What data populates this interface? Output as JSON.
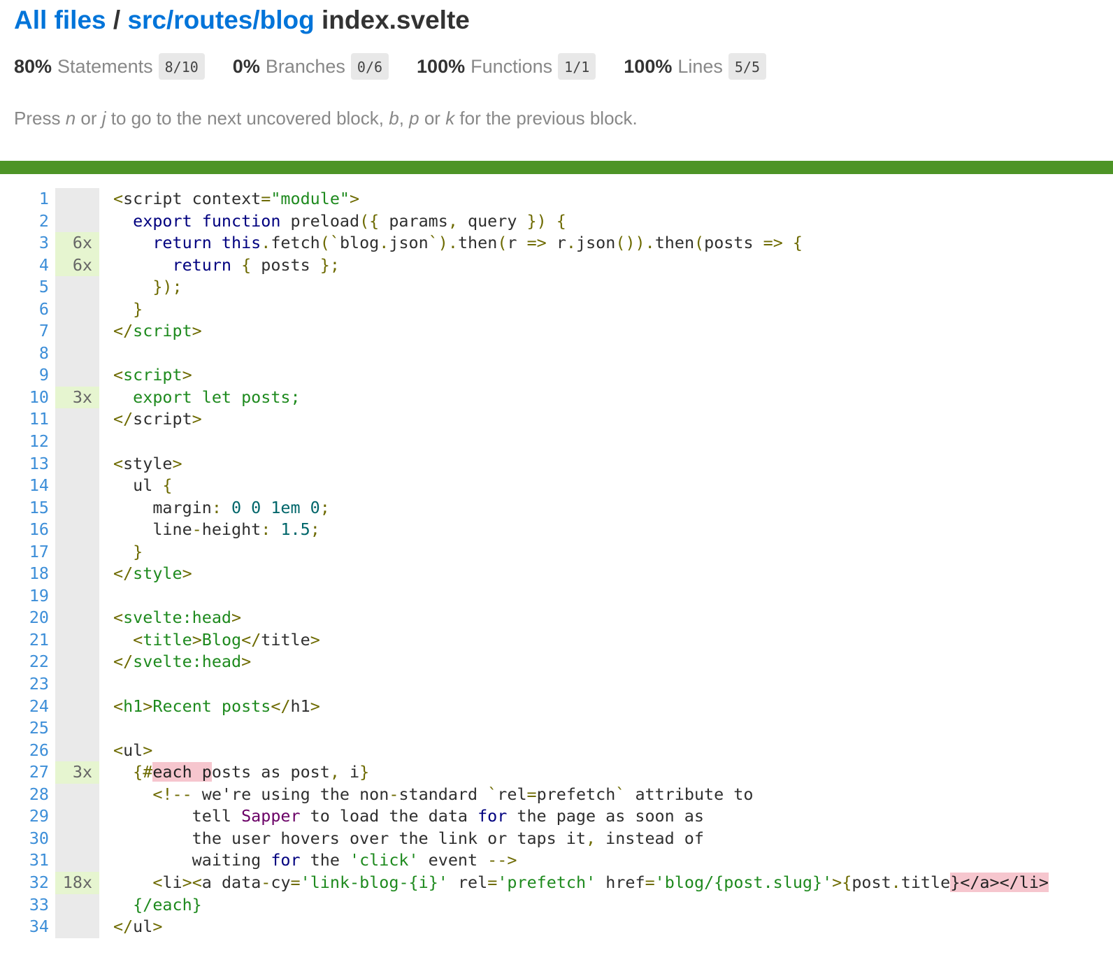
{
  "header": {
    "crumb_root": "All files",
    "crumb_sep": " / ",
    "crumb_dir": "src/routes/blog",
    "file_name": "index.svelte"
  },
  "summary": [
    {
      "pct": "80%",
      "name": "Statements",
      "frac": "8/10"
    },
    {
      "pct": "0%",
      "name": "Branches",
      "frac": "0/6"
    },
    {
      "pct": "100%",
      "name": "Functions",
      "frac": "1/1"
    },
    {
      "pct": "100%",
      "name": "Lines",
      "frac": "5/5"
    }
  ],
  "hint": {
    "p1": "Press ",
    "k1": "n",
    "p2": " or ",
    "k2": "j",
    "p3": " to go to the next uncovered block, ",
    "k3": "b",
    "p4": ", ",
    "k4": "p",
    "p5": " or ",
    "k5": "k",
    "p6": " for the previous block."
  },
  "colors": {
    "status_bar": "#4d9426",
    "link": "#0074d9",
    "covered": "#e6f5d0",
    "uncovered": "#f6c6ce"
  },
  "code_lines": [
    {
      "n": "1",
      "hits": "",
      "segs": [
        [
          "pu",
          "<"
        ],
        [
          "tg",
          "script context"
        ],
        [
          "pu",
          "="
        ],
        [
          "gr",
          "\"module\""
        ],
        [
          "pu",
          ">"
        ]
      ]
    },
    {
      "n": "2",
      "hits": "",
      "segs": [
        [
          "tg",
          "  "
        ],
        [
          "kw",
          "export function"
        ],
        [
          "tg",
          " preload"
        ],
        [
          "pu",
          "({"
        ],
        [
          "tg",
          " params"
        ],
        [
          "pu",
          ","
        ],
        [
          "tg",
          " query "
        ],
        [
          "pu",
          "}) {"
        ]
      ]
    },
    {
      "n": "3",
      "hits": "6x",
      "segs": [
        [
          "tg",
          "    "
        ],
        [
          "kw",
          "return this"
        ],
        [
          "pu",
          "."
        ],
        [
          "tg",
          "fetch"
        ],
        [
          "pu",
          "(`"
        ],
        [
          "tg",
          "blog"
        ],
        [
          "pu",
          "."
        ],
        [
          "tg",
          "json"
        ],
        [
          "pu",
          "`)."
        ],
        [
          "tg",
          "then"
        ],
        [
          "pu",
          "("
        ],
        [
          "tg",
          "r "
        ],
        [
          "pu",
          "=>"
        ],
        [
          "tg",
          " r"
        ],
        [
          "pu",
          "."
        ],
        [
          "tg",
          "json"
        ],
        [
          "pu",
          "())."
        ],
        [
          "tg",
          "then"
        ],
        [
          "pu",
          "("
        ],
        [
          "tg",
          "posts "
        ],
        [
          "pu",
          "=> {"
        ]
      ]
    },
    {
      "n": "4",
      "hits": "6x",
      "segs": [
        [
          "tg",
          "      "
        ],
        [
          "kw",
          "return"
        ],
        [
          "pu",
          " {"
        ],
        [
          "tg",
          " posts "
        ],
        [
          "pu",
          "};"
        ]
      ]
    },
    {
      "n": "5",
      "hits": "",
      "segs": [
        [
          "tg",
          "    "
        ],
        [
          "pu",
          "});"
        ]
      ]
    },
    {
      "n": "6",
      "hits": "",
      "segs": [
        [
          "tg",
          "  "
        ],
        [
          "pu",
          "}"
        ]
      ]
    },
    {
      "n": "7",
      "hits": "",
      "segs": [
        [
          "pu",
          "</"
        ],
        [
          "gr",
          "script"
        ],
        [
          "pu",
          ">"
        ]
      ]
    },
    {
      "n": "8",
      "hits": "",
      "segs": []
    },
    {
      "n": "9",
      "hits": "",
      "segs": [
        [
          "pu",
          "<"
        ],
        [
          "gr",
          "script"
        ],
        [
          "pu",
          ">"
        ]
      ]
    },
    {
      "n": "10",
      "hits": "3x",
      "segs": [
        [
          "tg",
          "  "
        ],
        [
          "gr",
          "export let posts;"
        ]
      ]
    },
    {
      "n": "11",
      "hits": "",
      "segs": [
        [
          "pu",
          "</"
        ],
        [
          "tg",
          "script"
        ],
        [
          "pu",
          ">"
        ]
      ]
    },
    {
      "n": "12",
      "hits": "",
      "segs": []
    },
    {
      "n": "13",
      "hits": "",
      "segs": [
        [
          "pu",
          "<"
        ],
        [
          "tg",
          "style"
        ],
        [
          "pu",
          ">"
        ]
      ]
    },
    {
      "n": "14",
      "hits": "",
      "segs": [
        [
          "tg",
          "  ul "
        ],
        [
          "pu",
          "{"
        ]
      ]
    },
    {
      "n": "15",
      "hits": "",
      "segs": [
        [
          "tg",
          "    margin"
        ],
        [
          "pu",
          ":"
        ],
        [
          "nm",
          " 0 0 1em 0"
        ],
        [
          "pu",
          ";"
        ]
      ]
    },
    {
      "n": "16",
      "hits": "",
      "segs": [
        [
          "tg",
          "    line"
        ],
        [
          "pu",
          "-"
        ],
        [
          "tg",
          "height"
        ],
        [
          "pu",
          ":"
        ],
        [
          "nm",
          " 1.5"
        ],
        [
          "pu",
          ";"
        ]
      ]
    },
    {
      "n": "17",
      "hits": "",
      "segs": [
        [
          "tg",
          "  "
        ],
        [
          "pu",
          "}"
        ]
      ]
    },
    {
      "n": "18",
      "hits": "",
      "segs": [
        [
          "pu",
          "</"
        ],
        [
          "gr",
          "style"
        ],
        [
          "pu",
          ">"
        ]
      ]
    },
    {
      "n": "19",
      "hits": "",
      "segs": []
    },
    {
      "n": "20",
      "hits": "",
      "segs": [
        [
          "pu",
          "<"
        ],
        [
          "gr",
          "svelte:head"
        ],
        [
          "pu",
          ">"
        ]
      ]
    },
    {
      "n": "21",
      "hits": "",
      "segs": [
        [
          "tg",
          "  "
        ],
        [
          "pu",
          "<"
        ],
        [
          "gr",
          "title"
        ],
        [
          "pu",
          ">"
        ],
        [
          "gr",
          "Blog"
        ],
        [
          "pu",
          "</"
        ],
        [
          "tg",
          "title"
        ],
        [
          "pu",
          ">"
        ]
      ]
    },
    {
      "n": "22",
      "hits": "",
      "segs": [
        [
          "pu",
          "</"
        ],
        [
          "gr",
          "svelte:head"
        ],
        [
          "pu",
          ">"
        ]
      ]
    },
    {
      "n": "23",
      "hits": "",
      "segs": []
    },
    {
      "n": "24",
      "hits": "",
      "segs": [
        [
          "pu",
          "<"
        ],
        [
          "gr",
          "h1"
        ],
        [
          "pu",
          ">"
        ],
        [
          "gr",
          "Recent posts"
        ],
        [
          "pu",
          "</"
        ],
        [
          "tg",
          "h1"
        ],
        [
          "pu",
          ">"
        ]
      ]
    },
    {
      "n": "25",
      "hits": "",
      "segs": []
    },
    {
      "n": "26",
      "hits": "",
      "segs": [
        [
          "pu",
          "<"
        ],
        [
          "tg",
          "ul"
        ],
        [
          "pu",
          ">"
        ]
      ]
    },
    {
      "n": "27",
      "hits": "3x",
      "segs": [
        [
          "tg",
          "  "
        ],
        [
          "pu",
          "{#"
        ],
        [
          "uncov",
          "each p"
        ],
        [
          "tg",
          "osts as post"
        ],
        [
          "pu",
          ","
        ],
        [
          "tg",
          " i"
        ],
        [
          "pu",
          "}"
        ]
      ]
    },
    {
      "n": "28",
      "hits": "",
      "segs": [
        [
          "tg",
          "    "
        ],
        [
          "pu",
          "<!--"
        ],
        [
          "tg",
          " we're using the non"
        ],
        [
          "pu",
          "-"
        ],
        [
          "tg",
          "standard "
        ],
        [
          "pu",
          "`"
        ],
        [
          "tg",
          "rel"
        ],
        [
          "pu",
          "="
        ],
        [
          "tg",
          "prefetch"
        ],
        [
          "pu",
          "`"
        ],
        [
          "tg",
          " attribute to"
        ]
      ]
    },
    {
      "n": "29",
      "hits": "",
      "segs": [
        [
          "tg",
          "        tell "
        ],
        [
          "pp",
          "Sapper"
        ],
        [
          "tg",
          " to load the data "
        ],
        [
          "kw",
          "for"
        ],
        [
          "tg",
          " the page as soon as"
        ]
      ]
    },
    {
      "n": "30",
      "hits": "",
      "segs": [
        [
          "tg",
          "        the user hovers over the link or taps it"
        ],
        [
          "pu",
          ","
        ],
        [
          "tg",
          " instead of"
        ]
      ]
    },
    {
      "n": "31",
      "hits": "",
      "segs": [
        [
          "tg",
          "        waiting "
        ],
        [
          "kw",
          "for"
        ],
        [
          "tg",
          " the "
        ],
        [
          "gr",
          "'click'"
        ],
        [
          "tg",
          " event "
        ],
        [
          "pu",
          "-->"
        ]
      ]
    },
    {
      "n": "32",
      "hits": "18x",
      "segs": [
        [
          "tg",
          "    "
        ],
        [
          "pu",
          "<"
        ],
        [
          "tg",
          "li"
        ],
        [
          "pu",
          "><"
        ],
        [
          "tg",
          "a data"
        ],
        [
          "pu",
          "-"
        ],
        [
          "tg",
          "cy"
        ],
        [
          "pu",
          "="
        ],
        [
          "gr",
          "'link-blog-{i}'"
        ],
        [
          "tg",
          " rel"
        ],
        [
          "pu",
          "="
        ],
        [
          "gr",
          "'prefetch'"
        ],
        [
          "tg",
          " href"
        ],
        [
          "pu",
          "="
        ],
        [
          "gr",
          "'blog/{post.slug}'"
        ],
        [
          "pu",
          ">{"
        ],
        [
          "tg",
          "post"
        ],
        [
          "pu",
          "."
        ],
        [
          "tg",
          "title"
        ],
        [
          "uncov",
          "}</a></li>"
        ]
      ]
    },
    {
      "n": "33",
      "hits": "",
      "segs": [
        [
          "tg",
          "  "
        ],
        [
          "gr",
          "{/each}"
        ]
      ]
    },
    {
      "n": "34",
      "hits": "",
      "segs": [
        [
          "pu",
          "</"
        ],
        [
          "tg",
          "ul"
        ],
        [
          "pu",
          ">"
        ]
      ]
    }
  ]
}
